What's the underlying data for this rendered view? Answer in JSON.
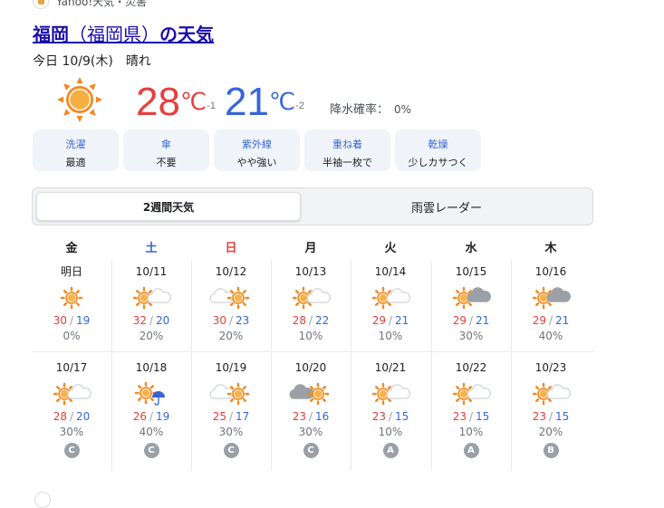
{
  "source": {
    "label": "Yahoo!天気・災害"
  },
  "title": {
    "city": "福岡",
    "open": "（",
    "pref": "福岡県",
    "close": "）",
    "tail": "の天気"
  },
  "today": {
    "label": "今日 10/9(木)",
    "weather": "晴れ"
  },
  "current": {
    "high": "28",
    "high_unit": "℃",
    "high_diff": "-1",
    "low": "21",
    "low_unit": "℃",
    "low_diff": "-2",
    "rain_label": "降水確率：",
    "rain_value": "0%"
  },
  "indices": [
    {
      "key": "洗濯",
      "value": "最適"
    },
    {
      "key": "傘",
      "value": "不要"
    },
    {
      "key": "紫外線",
      "value": "やや強い"
    },
    {
      "key": "重ね着",
      "value": "半袖一枚で"
    },
    {
      "key": "乾燥",
      "value": "少しカサつく"
    }
  ],
  "tabs": {
    "selected": "2週間天気",
    "other": "雨雲レーダー"
  },
  "weekdays": [
    "金",
    "土",
    "日",
    "月",
    "火",
    "水",
    "木"
  ],
  "week1": [
    {
      "date": "明日",
      "icon": "sun-icon",
      "hi": "30",
      "lo": "19",
      "pop": "0%"
    },
    {
      "date": "10/11",
      "icon": "sun-cloud-icon",
      "hi": "32",
      "lo": "20",
      "pop": "20%"
    },
    {
      "date": "10/12",
      "icon": "cloud-sun-icon",
      "hi": "30",
      "lo": "23",
      "pop": "20%"
    },
    {
      "date": "10/13",
      "icon": "sun-cloud-icon",
      "hi": "28",
      "lo": "22",
      "pop": "10%"
    },
    {
      "date": "10/14",
      "icon": "sun-cloud-icon",
      "hi": "29",
      "lo": "21",
      "pop": "10%"
    },
    {
      "date": "10/15",
      "icon": "sun-darkcloud-icon",
      "hi": "29",
      "lo": "21",
      "pop": "30%"
    },
    {
      "date": "10/16",
      "icon": "sun-darkcloud-icon",
      "hi": "29",
      "lo": "21",
      "pop": "40%"
    }
  ],
  "week2": [
    {
      "date": "10/17",
      "icon": "sun-cloud-icon",
      "hi": "28",
      "lo": "20",
      "pop": "30%",
      "rel": "C"
    },
    {
      "date": "10/18",
      "icon": "sun-umbrella-icon",
      "hi": "26",
      "lo": "19",
      "pop": "40%",
      "rel": "C"
    },
    {
      "date": "10/19",
      "icon": "cloud-sun-icon",
      "hi": "25",
      "lo": "17",
      "pop": "30%",
      "rel": "C"
    },
    {
      "date": "10/20",
      "icon": "darkcloud-sun-icon",
      "hi": "23",
      "lo": "16",
      "pop": "30%",
      "rel": "C"
    },
    {
      "date": "10/21",
      "icon": "sun-cloud-icon",
      "hi": "23",
      "lo": "15",
      "pop": "10%",
      "rel": "A"
    },
    {
      "date": "10/22",
      "icon": "sun-cloud-icon",
      "hi": "23",
      "lo": "15",
      "pop": "10%",
      "rel": "A"
    },
    {
      "date": "10/23",
      "icon": "sun-cloud-icon",
      "hi": "23",
      "lo": "15",
      "pop": "20%",
      "rel": "B"
    }
  ],
  "colors": {
    "high": "#e83e3e",
    "low": "#3666d6",
    "sun": "#f5871f",
    "cloud": "#d0d4d8",
    "darkcloud": "#9aa0a6",
    "link": "#1a0dab"
  }
}
